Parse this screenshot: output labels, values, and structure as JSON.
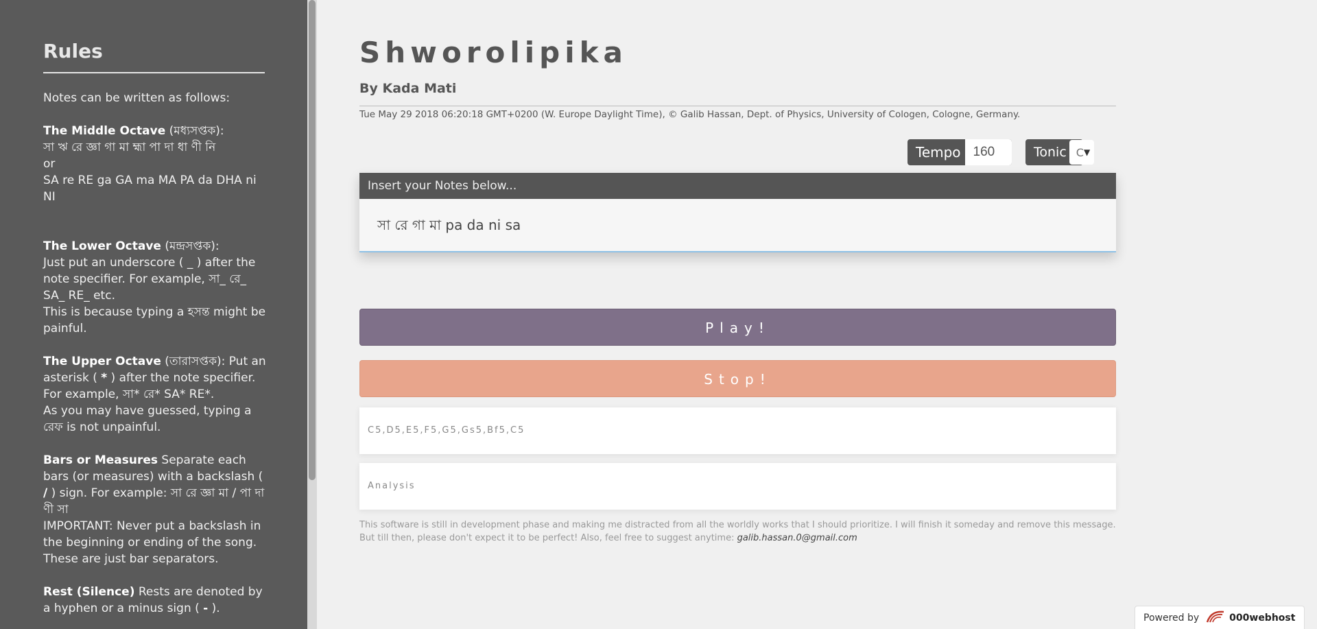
{
  "sidebar": {
    "title": "Rules",
    "intro": "Notes can be written as follows:",
    "middle": {
      "heading": "The Middle Octave",
      "heading_bn": " (মধ্যসপ্তক):",
      "line1": "সা ঋ রে জ্ঞা গা মা হ্মা পা দা ধা ণী নি",
      "or": "or",
      "line2": "SA re RE ga GA ma MA PA da DHA ni NI"
    },
    "lower": {
      "heading": "The Lower Octave",
      "heading_bn": " (মন্দ্রসপ্তক):",
      "text1": "Just put an underscore ( _ ) after the note specifier. For example, সা_ রে_ SA_ RE_ etc.",
      "text2": "This is because typing a হসন্ত might be painful."
    },
    "upper": {
      "heading": "The Upper Octave",
      "text1_a": " (তারাসপ্তক): Put an asterisk ( ",
      "star": "*",
      "text1_b": " ) after the note specifier. For example, সা* রে* SA* RE*.",
      "text2": "As you may have guessed, typing a রেফ is not unpainful."
    },
    "bars": {
      "heading": "Bars or Measures",
      "text1_a": " Separate each bars (or measures) with a backslash ( ",
      "slash": "/",
      "text1_b": " ) sign. For example: সা রে জ্ঞা মা / পা দা ণী সা",
      "text2": "IMPORTANT: Never put a backslash in the beginning or ending of the song. These are just bar separators."
    },
    "rest": {
      "heading": "Rest (Silence)",
      "text_a": " Rests are denoted by a hyphen or a minus sign ( ",
      "dash": "-",
      "text_b": " )."
    }
  },
  "main": {
    "title": "Shworolipika",
    "byline": "By Kada Mati",
    "dateline": "Tue May 29 2018 06:20:18 GMT+0200 (W. Europe Daylight Time), © Galib Hassan, Dept. of Physics, University of Cologen, Cologne, Germany.",
    "tempo": {
      "label": "Tempo",
      "value": "160"
    },
    "tonic": {
      "label": "Tonic",
      "value": "C"
    },
    "notes": {
      "header": "Insert your Notes below...",
      "value": "সা রে গা মা pa da ni sa"
    },
    "play_label": "Play!",
    "stop_label": "Stop!",
    "converted_notes": "C5,D5,E5,F5,G5,Gs5,Bf5,C5",
    "analysis_label": "Analysis",
    "disclaimer": "This software is still in development phase and making me distracted from all the worldly works that I should prioritize. I will finish it someday and remove this message. But till then, please don't expect it to be perfect! Also, feel free to suggest anytime: ",
    "email": "galib.hassan.0@gmail.com"
  },
  "footer": {
    "powered_by": "Powered by",
    "brand": "000webhost"
  }
}
